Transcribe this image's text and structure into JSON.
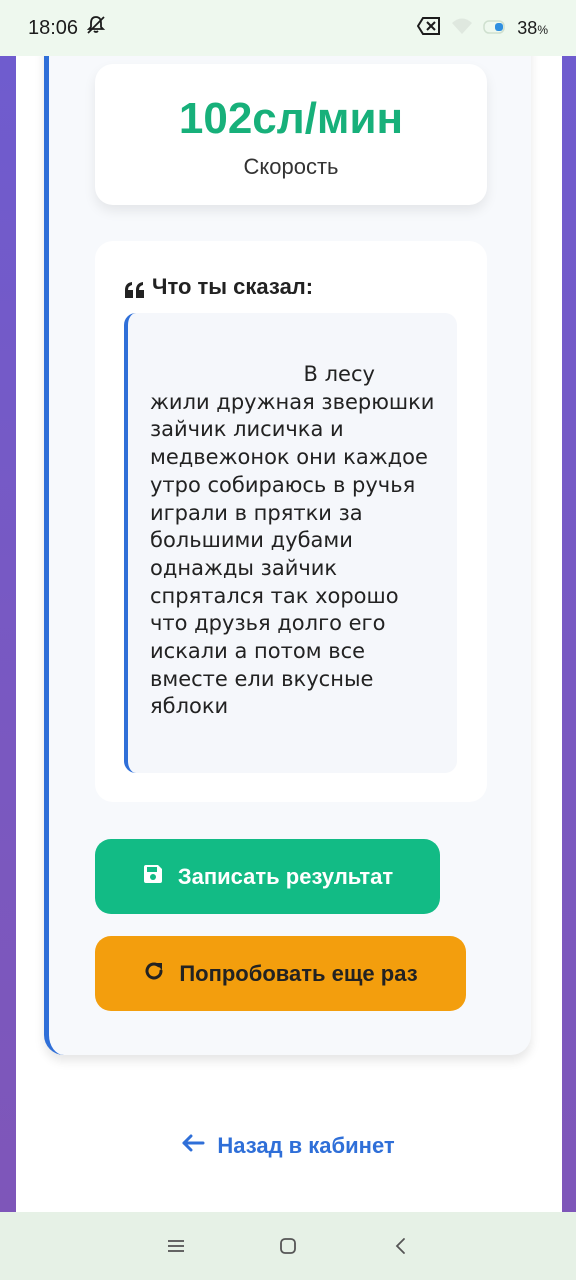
{
  "status_bar": {
    "time": "18:06",
    "battery_percent": "38",
    "battery_unit": "%",
    "icons": [
      "bell-off-icon",
      "sim-blocked-icon",
      "wifi-icon",
      "battery-icon"
    ]
  },
  "result": {
    "speed_value": "102сл/мин",
    "speed_label": "Скорость"
  },
  "transcript": {
    "title": "Что ты сказал:",
    "text": "                       В лесу жили дружная зверюшки зайчик лисичка и медвежонок они каждое утро собираюсь в ручья играли в прятки за большими дубами однажды зайчик спрятался так хорошо что друзья долго его искали а потом все вместе ели вкусные яблоки"
  },
  "actions": {
    "save_label": "Записать результат",
    "retry_label": "Попробовать еще раз",
    "back_label": "Назад в кабинет"
  },
  "colors": {
    "accent_blue": "#2f6fd8",
    "speed_green": "#17b07a",
    "save_green": "#12bb85",
    "retry_orange": "#f39e0d"
  },
  "nav": {
    "icons": [
      "menu-icon",
      "home-square-icon",
      "back-chevron-icon"
    ]
  }
}
